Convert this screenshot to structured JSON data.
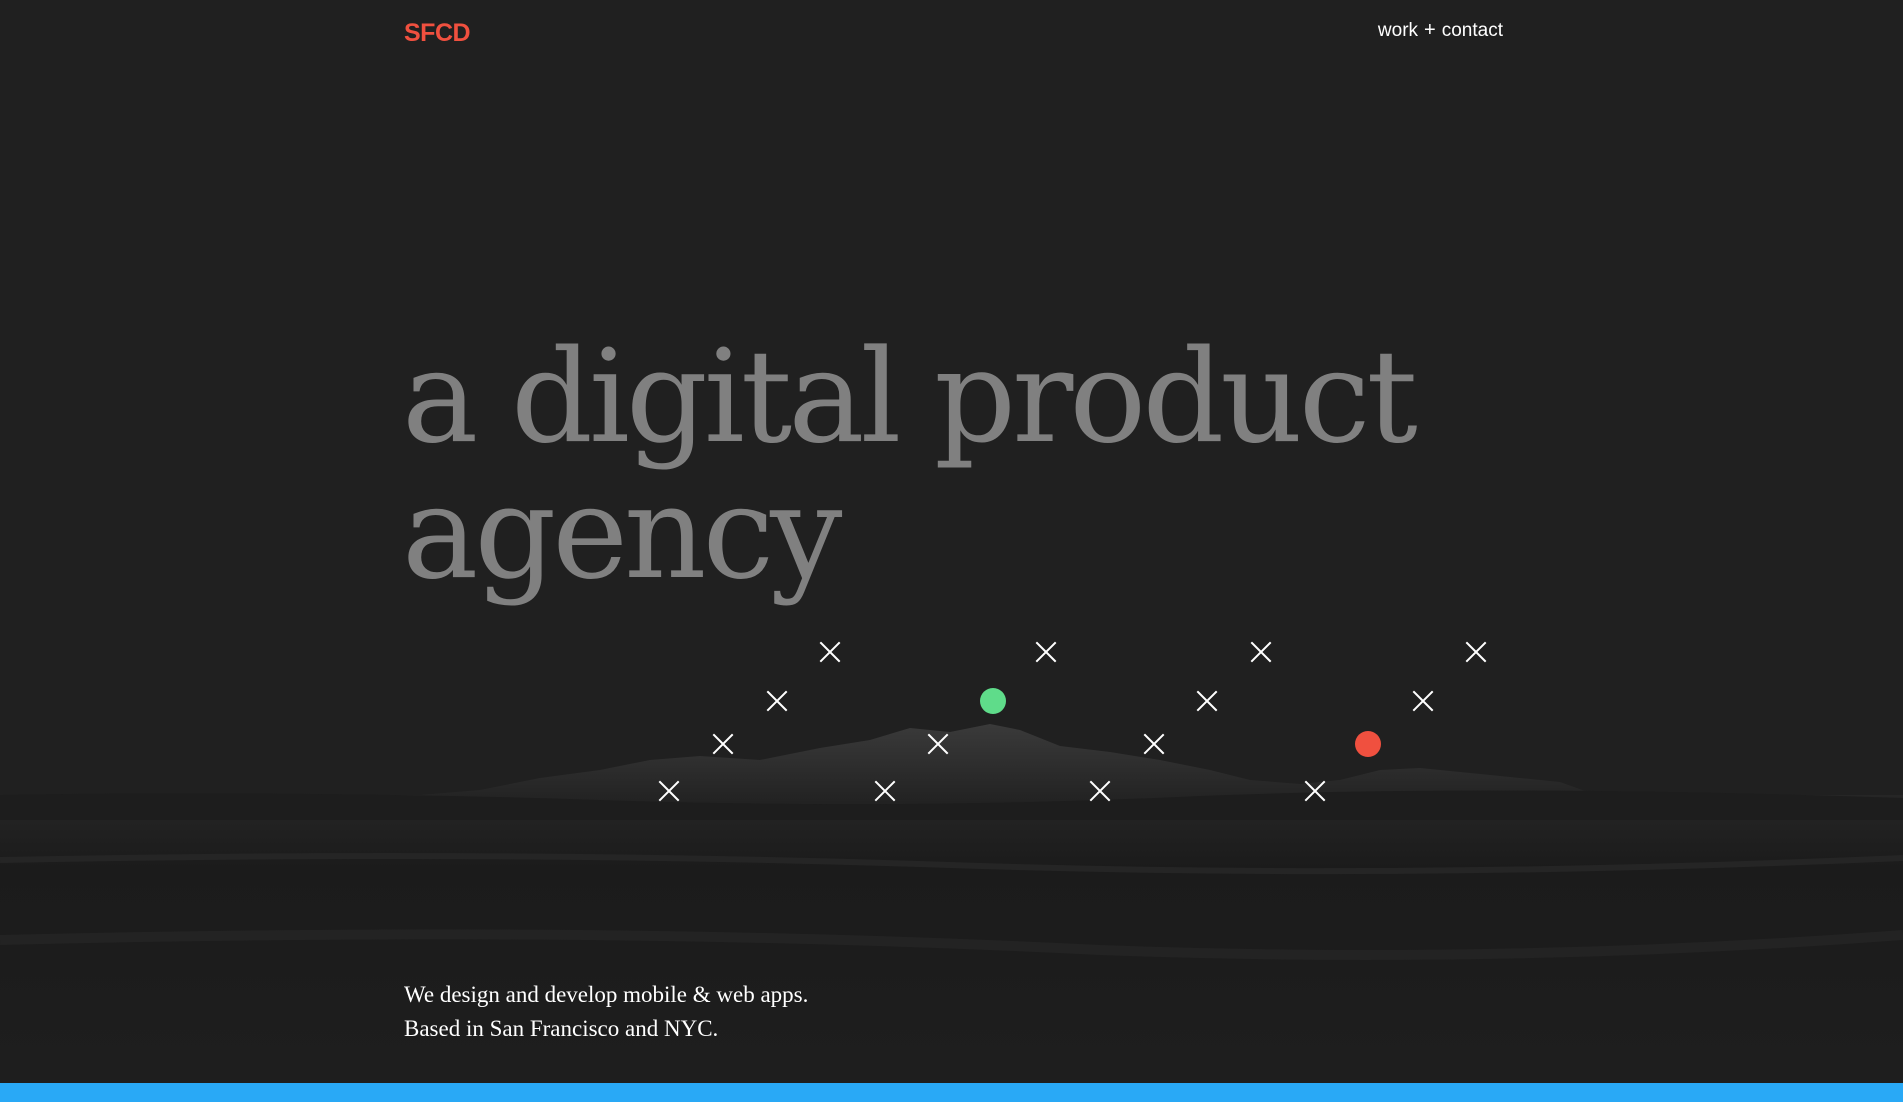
{
  "header": {
    "logo": "SFCD",
    "nav": {
      "work_label": "work",
      "separator": "+",
      "contact_label": "contact"
    }
  },
  "hero": {
    "headline_line1": "a digital product",
    "headline_line2": "agency"
  },
  "tagline": {
    "line1": "We design and develop mobile & web apps.",
    "line2": "Based in San Francisco and NYC."
  },
  "marks": {
    "cross_color": "#ffffff",
    "green_dot_color": "#5fdc8a",
    "red_dot_color": "#f0503f",
    "icons": [
      "close-icon",
      "dot-icon"
    ]
  },
  "colors": {
    "background": "#202020",
    "logo": "#f0503f",
    "headline": "#808080",
    "bottom_bar": "#29a9f6"
  }
}
